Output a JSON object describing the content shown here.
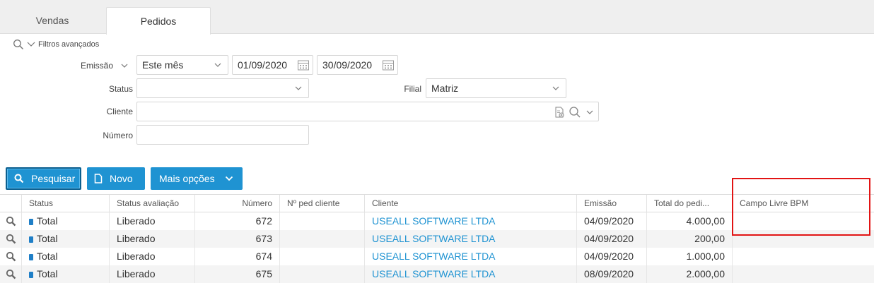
{
  "tabs": [
    {
      "label": "Vendas",
      "active": false
    },
    {
      "label": "Pedidos",
      "active": true
    }
  ],
  "filters": {
    "toggle_label": "Filtros avançados",
    "emissao": {
      "label": "Emissão",
      "period": "Este mês",
      "date_from": "01/09/2020",
      "date_to": "30/09/2020"
    },
    "status": {
      "label": "Status",
      "value": ""
    },
    "filial": {
      "label": "Filial",
      "value": "Matriz"
    },
    "cliente": {
      "label": "Cliente",
      "value": ""
    },
    "numero": {
      "label": "Número",
      "value": ""
    }
  },
  "toolbar": {
    "search_label": "Pesquisar",
    "new_label": "Novo",
    "more_label": "Mais opções"
  },
  "table": {
    "columns": [
      "Status",
      "Status avaliação",
      "Número",
      "Nº ped cliente",
      "Cliente",
      "Emissão",
      "Total do pedi...",
      "Campo Livre BPM"
    ],
    "rows": [
      {
        "status": "Total",
        "avaliacao": "Liberado",
        "numero": "672",
        "ped_cliente": "",
        "cliente": "USEALL SOFTWARE LTDA",
        "emissao": "04/09/2020",
        "total": "4.000,00",
        "campo_livre": ""
      },
      {
        "status": "Total",
        "avaliacao": "Liberado",
        "numero": "673",
        "ped_cliente": "",
        "cliente": "USEALL SOFTWARE LTDA",
        "emissao": "04/09/2020",
        "total": "200,00",
        "campo_livre": ""
      },
      {
        "status": "Total",
        "avaliacao": "Liberado",
        "numero": "674",
        "ped_cliente": "",
        "cliente": "USEALL SOFTWARE LTDA",
        "emissao": "04/09/2020",
        "total": "1.000,00",
        "campo_livre": ""
      },
      {
        "status": "Total",
        "avaliacao": "Liberado",
        "numero": "675",
        "ped_cliente": "",
        "cliente": "USEALL SOFTWARE LTDA",
        "emissao": "08/09/2020",
        "total": "2.000,00",
        "campo_livre": ""
      }
    ]
  },
  "colors": {
    "accent": "#1f93d2",
    "highlight": "#e21414",
    "status_dot": "#1f7fc7"
  },
  "icons": [
    "search-icon",
    "chevron-down-icon",
    "calendar-icon",
    "document-icon",
    "magnifier-row-icon"
  ]
}
